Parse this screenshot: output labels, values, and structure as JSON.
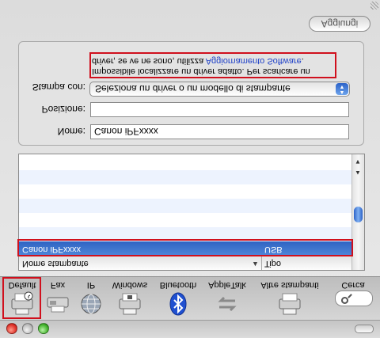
{
  "toolbar": {
    "items": [
      {
        "label": "Default",
        "icon": "printer-default-icon"
      },
      {
        "label": "Fax",
        "icon": "fax-icon"
      },
      {
        "label": "IP",
        "icon": "globe-icon"
      },
      {
        "label": "Windows",
        "icon": "printer-windows-icon"
      },
      {
        "label": "Bluetooth",
        "icon": "bluetooth-icon"
      },
      {
        "label": "AppleTalk",
        "icon": "appletalk-icon"
      },
      {
        "label": "Altre stampanti",
        "icon": "printer-other-icon"
      },
      {
        "label": "Cerca",
        "icon": "search-icon"
      }
    ]
  },
  "printer_list": {
    "columns": {
      "name": "Nome stampante",
      "type": "Tipo"
    },
    "rows": [
      {
        "name": "Canon iPFxxxx",
        "type": "USB",
        "selected": true
      }
    ]
  },
  "form": {
    "name_label": "Nome:",
    "name_value": "Canon iPFxxxx",
    "location_label": "Posizione:",
    "location_value": "",
    "print_with_label": "Stampa con:",
    "print_with_value": "Seleziona un driver o un modello di stampante",
    "message_line1": "Impossibile localizzare un driver adatto. Per scaricare un",
    "message_line2": "driver, se ve ne sono, utilizza ",
    "message_link": "Aggiornamento Software",
    "message_end": "."
  },
  "buttons": {
    "add": "Aggiungi"
  },
  "colors": {
    "highlight": "#d0101d",
    "selection": "#3a6fcf",
    "link": "#1d3fc7"
  }
}
